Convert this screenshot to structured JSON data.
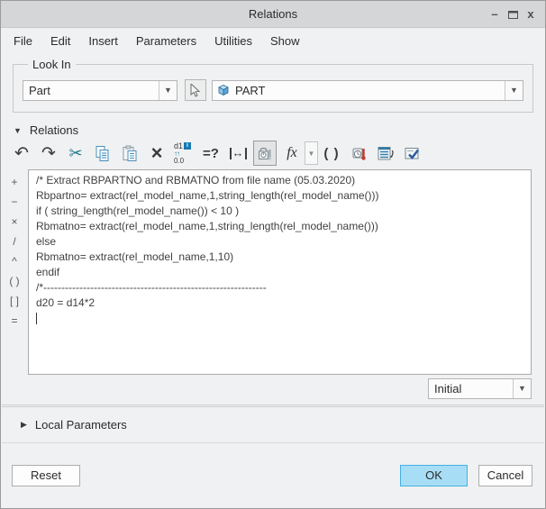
{
  "window": {
    "title": "Relations",
    "controls": {
      "minimize": "–",
      "close": "x"
    }
  },
  "menu": {
    "items": [
      "File",
      "Edit",
      "Insert",
      "Parameters",
      "Utilities",
      "Show"
    ]
  },
  "look_in": {
    "label": "Look In",
    "scope_value": "Part",
    "target_value": "PART",
    "dropdown_arrow": "▼"
  },
  "relations_section": {
    "collapse_arrow": "▼",
    "label": "Relations"
  },
  "toolbar": {
    "undo_glyph": "↶",
    "redo_glyph": "↷",
    "cut_glyph": "✂",
    "delete_glyph": "×",
    "dim_top": "d1",
    "dim_info": "i",
    "dim_arrows": "↑↑",
    "dim_bottom": "0.0",
    "evaluate_label": "=?",
    "measure_glyph": "↔",
    "function_label": "fx",
    "function_dropdown_arrow": "▼",
    "operators_label": "( )"
  },
  "operators": [
    "+",
    "−",
    "×",
    "/",
    "^",
    "( )",
    "[ ]",
    "="
  ],
  "editor": {
    "lines": [
      "/* Extract RBPARTNO and RBMATNO from file name (05.03.2020)",
      "Rbpartno= extract(rel_model_name,1,string_length(rel_model_name()))",
      "if ( string_length(rel_model_name()) < 10 )",
      "Rbmatno= extract(rel_model_name,1,string_length(rel_model_name()))",
      "else",
      "Rbmatno= extract(rel_model_name,1,10)",
      "endif",
      "/*--------------------------------------------------------------",
      "d20 = d14*2"
    ]
  },
  "revision": {
    "value": "Initial",
    "dropdown_arrow": "▼"
  },
  "local_parameters": {
    "collapse_arrow": "▶",
    "label": "Local Parameters"
  },
  "footer": {
    "reset_label": "Reset",
    "ok_label": "OK",
    "cancel_label": "Cancel"
  },
  "colors": {
    "accent": "#a8ddf6",
    "accent_border": "#45b1e2",
    "icon_blue": "#4a90b8",
    "icon_teal": "#20768f"
  }
}
